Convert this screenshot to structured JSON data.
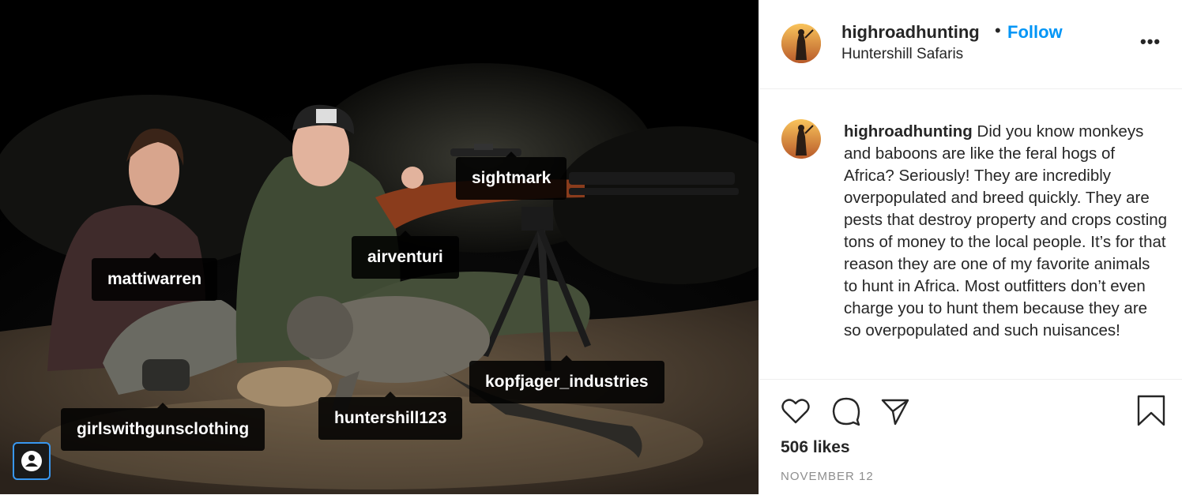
{
  "post": {
    "username": "highroadhunting",
    "follow_label": "Follow",
    "separator": "•",
    "location": "Huntershill Safaris",
    "more_label": "•••",
    "caption_username": "highroadhunting",
    "caption": "Did you know monkeys and baboons are like the feral hogs of Africa? Seriously! They are incredibly overpopulated and breed quickly. They are pests that destroy property and crops costing tons of money to the local people. It’s for that reason they are one of my favorite animals to hunt in Africa. Most outfitters don’t even charge you to hunt them because they are so overpopulated and such nuisances!",
    "likes": "506 likes",
    "date": "NOVEMBER 12"
  },
  "photo_tags": [
    "sightmark",
    "airventuri",
    "mattiwarren",
    "kopfjager_industries",
    "huntershill123",
    "girlswithgunsclothing"
  ],
  "icons": [
    "heart-icon",
    "comment-icon",
    "share-icon",
    "bookmark-icon",
    "user-tags-icon",
    "more-options-icon"
  ],
  "colors": {
    "accent": "#0095f6",
    "text": "#262626",
    "muted": "#8e8e8e",
    "border": "#efefef"
  }
}
